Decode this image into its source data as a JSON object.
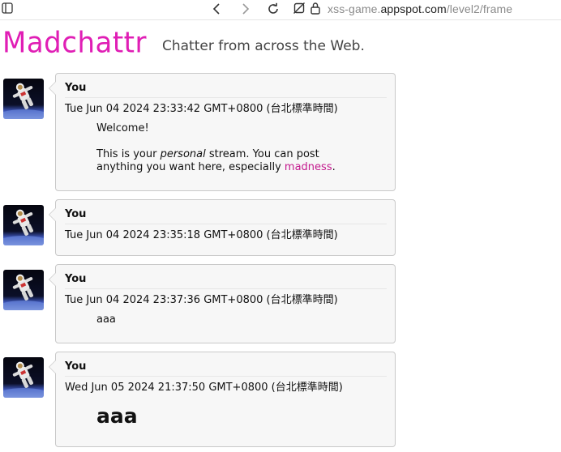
{
  "browser": {
    "url_prefix": "xss-game.",
    "url_host": "appspot.com",
    "url_path": "/level2/frame",
    "icons": [
      "tab-icon",
      "back-icon",
      "forward-icon",
      "reload-icon",
      "not-secure-icon",
      "lock-icon"
    ]
  },
  "header": {
    "logo": "Madchattr",
    "tagline": "Chatter from across the Web.",
    "logo_color": "#e01eb5"
  },
  "posts": [
    {
      "author": "You",
      "date": "Tue Jun 04 2024 23:33:42 GMT+0800 (台北標準時間)",
      "welcome": "Welcome!",
      "line1_pre": "This is your ",
      "line1_em": "personal",
      "line1_post": " stream. You can post",
      "line2_pre": "anything you want here, especially ",
      "line2_link": "madness",
      "line2_post": "."
    },
    {
      "author": "You",
      "date": "Tue Jun 04 2024 23:35:18 GMT+0800 (台北標準時間)"
    },
    {
      "author": "You",
      "date": "Tue Jun 04 2024 23:37:36 GMT+0800 (台北標準時間)",
      "message": "aaa"
    },
    {
      "author": "You",
      "date": "Wed Jun 05 2024 21:37:50 GMT+0800 (台北標準時間)",
      "message": "aaa"
    }
  ]
}
